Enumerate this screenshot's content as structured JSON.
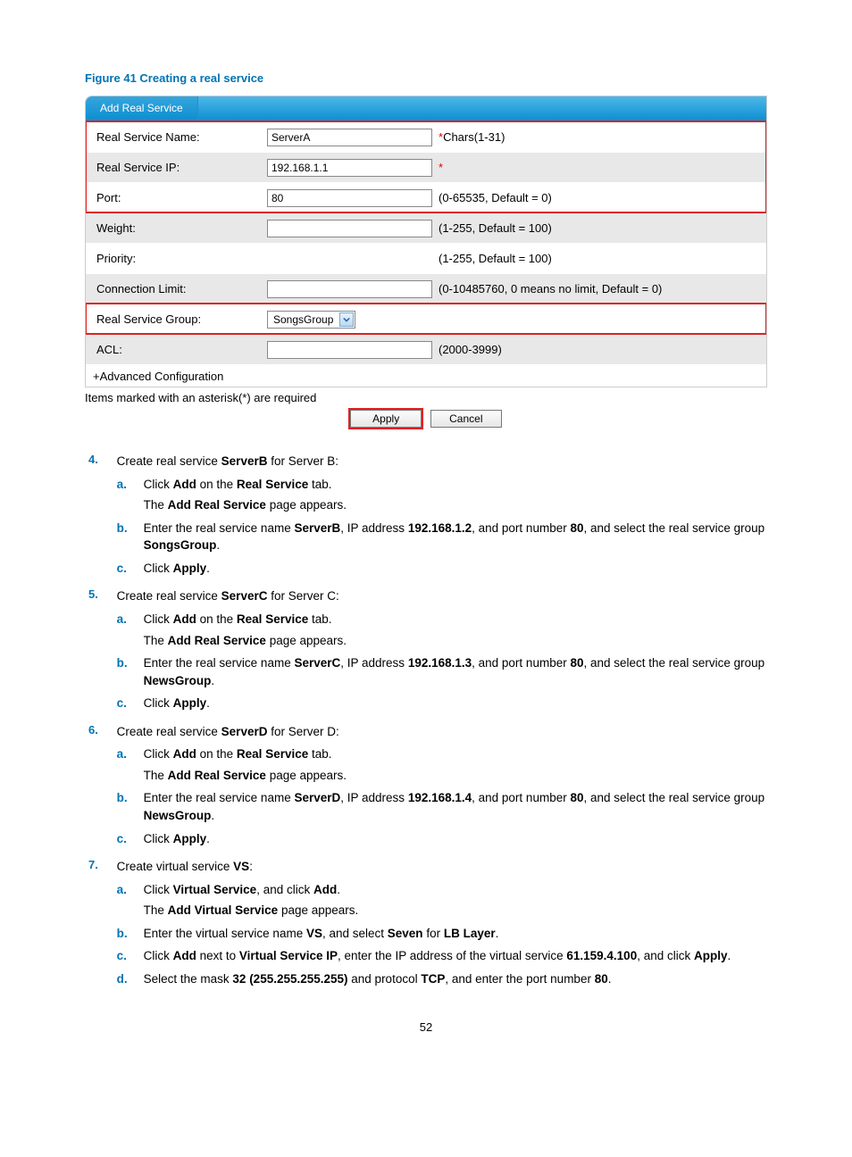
{
  "figure": {
    "caption": "Figure 41 Creating a real service"
  },
  "dialog": {
    "tab": "Add Real Service",
    "rows": {
      "name": {
        "label": "Real Service Name:",
        "value": "ServerA",
        "hint": "Chars(1-31)",
        "req": "*"
      },
      "ip": {
        "label": "Real Service IP:",
        "value": "192.168.1.1",
        "hint": "",
        "req": "*"
      },
      "port": {
        "label": "Port:",
        "value": "80",
        "hint": "(0-65535, Default = 0)"
      },
      "weight": {
        "label": "Weight:",
        "value": "",
        "hint": "(1-255, Default = 100)"
      },
      "priority": {
        "label": "Priority:",
        "value": "",
        "hint": "(1-255, Default = 100)"
      },
      "connlimit": {
        "label": "Connection Limit:",
        "value": "",
        "hint": "(0-10485760, 0 means no limit, Default = 0)"
      },
      "group": {
        "label": "Real Service Group:",
        "value": "SongsGroup"
      },
      "acl": {
        "label": "ACL:",
        "value": "",
        "hint": "(2000-3999)"
      }
    },
    "advanced": "+Advanced Configuration",
    "footnote": "Items marked with an asterisk(*) are required",
    "apply": "Apply",
    "cancel": "Cancel"
  },
  "steps": {
    "s4": {
      "num": "4.",
      "text_pre": "Create real service ",
      "text_bold": "ServerB",
      "text_post": " for Server B:",
      "sub": {
        "a": {
          "m": "a.",
          "t1": "Click ",
          "b1": "Add",
          "t2": " on the ",
          "b2": "Real Service",
          "t3": " tab.",
          "p1a": "The ",
          "p1b": "Add Real Service",
          "p1c": " page appears."
        },
        "b": {
          "m": "b.",
          "t1": "Enter the real service name ",
          "b1": "ServerB",
          "t2": ", IP address ",
          "b2": "192.168.1.2",
          "t3": ", and port number ",
          "b3": "80",
          "t4": ", and select the real service group ",
          "b4": "SongsGroup",
          "t5": "."
        },
        "c": {
          "m": "c.",
          "t1": "Click ",
          "b1": "Apply",
          "t2": "."
        }
      }
    },
    "s5": {
      "num": "5.",
      "text_pre": "Create real service ",
      "text_bold": "ServerC",
      "text_post": " for Server C:",
      "sub": {
        "a": {
          "m": "a.",
          "t1": "Click ",
          "b1": "Add",
          "t2": " on the ",
          "b2": "Real Service",
          "t3": " tab.",
          "p1a": "The ",
          "p1b": "Add Real Service",
          "p1c": " page appears."
        },
        "b": {
          "m": "b.",
          "t1": "Enter the real service name ",
          "b1": "ServerC",
          "t2": ", IP address ",
          "b2": "192.168.1.3",
          "t3": ", and port number ",
          "b3": "80",
          "t4": ", and select the real service group ",
          "b4": "NewsGroup",
          "t5": "."
        },
        "c": {
          "m": "c.",
          "t1": "Click ",
          "b1": "Apply",
          "t2": "."
        }
      }
    },
    "s6": {
      "num": "6.",
      "text_pre": "Create real service ",
      "text_bold": "ServerD",
      "text_post": " for Server D:",
      "sub": {
        "a": {
          "m": "a.",
          "t1": "Click ",
          "b1": "Add",
          "t2": " on the ",
          "b2": "Real Service",
          "t3": " tab.",
          "p1a": "The ",
          "p1b": "Add Real Service",
          "p1c": " page appears."
        },
        "b": {
          "m": "b.",
          "t1": "Enter the real service name ",
          "b1": "ServerD",
          "t2": ", IP address ",
          "b2": "192.168.1.4",
          "t3": ", and port number ",
          "b3": "80",
          "t4": ", and select the real service group ",
          "b4": "NewsGroup",
          "t5": "."
        },
        "c": {
          "m": "c.",
          "t1": "Click ",
          "b1": "Apply",
          "t2": "."
        }
      }
    },
    "s7": {
      "num": "7.",
      "text_pre": "Create virtual service ",
      "text_bold": "VS",
      "text_post": ":",
      "sub": {
        "a": {
          "m": "a.",
          "t1": "Click ",
          "b1": "Virtual Service",
          "t2": ", and click ",
          "b2": "Add",
          "t3": ".",
          "p1a": "The ",
          "p1b": "Add Virtual Service",
          "p1c": " page appears."
        },
        "b": {
          "m": "b.",
          "t1": "Enter the virtual service name ",
          "b1": "VS",
          "t2": ", and select ",
          "b2": "Seven",
          "t3": " for ",
          "b3": "LB Layer",
          "t4": "."
        },
        "c": {
          "m": "c.",
          "t1": "Click ",
          "b1": "Add",
          "t2": " next to ",
          "b2": "Virtual Service IP",
          "t3": ", enter the IP address of the virtual service ",
          "b3": "61.159.4.100",
          "t4": ", and click ",
          "b4": "Apply",
          "t5": "."
        },
        "d": {
          "m": "d.",
          "t1": "Select the mask ",
          "b1": "32 (255.255.255.255)",
          "t2": " and protocol ",
          "b2": "TCP",
          "t3": ", and enter the port number ",
          "b3": "80",
          "t4": "."
        }
      }
    }
  },
  "page": "52"
}
